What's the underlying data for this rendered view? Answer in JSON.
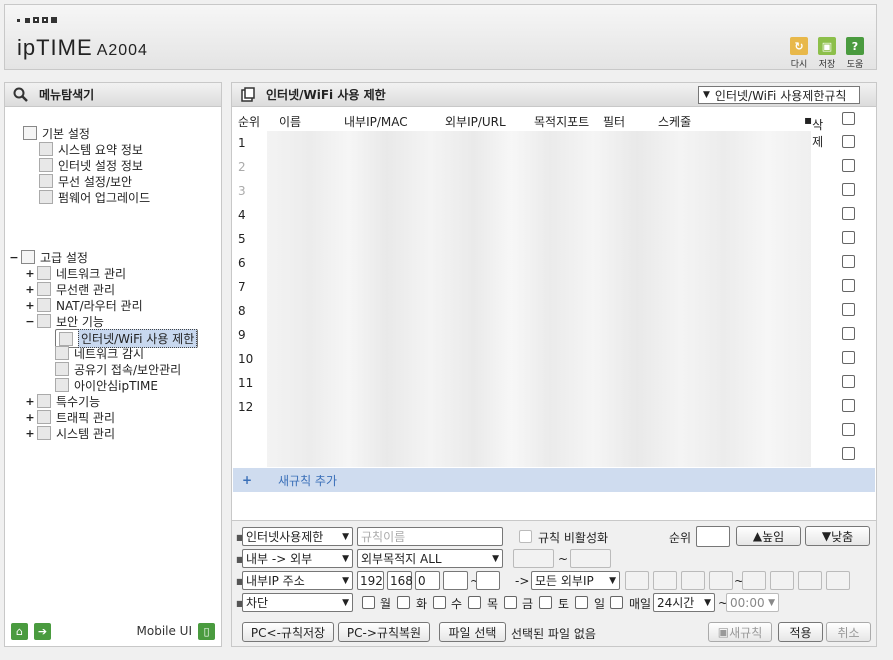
{
  "header": {
    "brand": "ipTIME",
    "model": "A2004",
    "tools": [
      {
        "icon": "refresh-icon",
        "label": "다시",
        "color": "#e8b84a"
      },
      {
        "icon": "save-icon",
        "label": "저장",
        "color": "#8cbf4a"
      },
      {
        "icon": "help-icon",
        "label": "도움",
        "color": "#4a9b3f"
      }
    ]
  },
  "nav": {
    "title": "메뉴탐색기",
    "basic": {
      "label": "기본 설정",
      "items": [
        "시스템 요약 정보",
        "인터넷 설정 정보",
        "무선 설정/보안",
        "펌웨어 업그레이드"
      ]
    },
    "advanced": {
      "toggle": "−",
      "label": "고급 설정",
      "items": [
        {
          "toggle": "+",
          "label": "네트워크 관리"
        },
        {
          "toggle": "+",
          "label": "무선랜 관리"
        },
        {
          "toggle": "+",
          "label": "NAT/라우터 관리"
        },
        {
          "toggle": "−",
          "label": "보안 기능"
        }
      ],
      "security_items": [
        "인터넷/WiFi 사용 제한",
        "네트워크 감시",
        "공유기 접속/보안관리",
        "아이안심ipTIME"
      ],
      "more_items": [
        {
          "toggle": "+",
          "label": "특수기능"
        },
        {
          "toggle": "+",
          "label": "트래픽 관리"
        },
        {
          "toggle": "+",
          "label": "시스템 관리"
        }
      ]
    },
    "footer": {
      "mobile_label": "Mobile UI"
    }
  },
  "main": {
    "title": "인터넷/WiFi 사용 제한",
    "rule_select": "인터넷/WiFi 사용제한규칙",
    "columns": {
      "rank": "순위",
      "name": "이름",
      "internal": "내부IP/MAC",
      "external": "외부IP/URL",
      "port": "목적지포트",
      "filter": "필터",
      "schedule": "스케줄",
      "delete": "삭제"
    },
    "rows": [
      "1",
      "2",
      "3",
      "4",
      "5",
      "6",
      "7",
      "8",
      "9",
      "10",
      "11",
      "12"
    ],
    "new_rule": {
      "plus": "+",
      "label": "새규칙 추가"
    }
  },
  "form": {
    "rule_type": "인터넷사용제한",
    "rule_name_placeholder": "규칙이름",
    "disable_label": "규칙 비활성화",
    "rank_label": "순위",
    "rank_value": "",
    "up_label": "높임",
    "down_label": "낮춤",
    "direction": "내부 -> 외부",
    "destination": "외부목적지 ALL",
    "port_sep": "~",
    "ip_type": "내부IP 주소",
    "ip": [
      "192",
      "168",
      "0",
      "",
      ""
    ],
    "ip_sep": "~",
    "arrow": "->",
    "external_ip": "모든 외부IP",
    "action": "차단",
    "days": [
      "월",
      "화",
      "수",
      "목",
      "금",
      "토",
      "일"
    ],
    "everyday": "매일",
    "hours": "24시간",
    "time_sep": "~",
    "time": "00:00",
    "backup_label": "PC<-규칙저장",
    "restore_label": "PC->규칙복원",
    "file_label": "파일 선택",
    "file_status": "선택된 파일 없음",
    "new_button": "새규칙",
    "apply_button": "적용",
    "cancel_button": "취소"
  }
}
